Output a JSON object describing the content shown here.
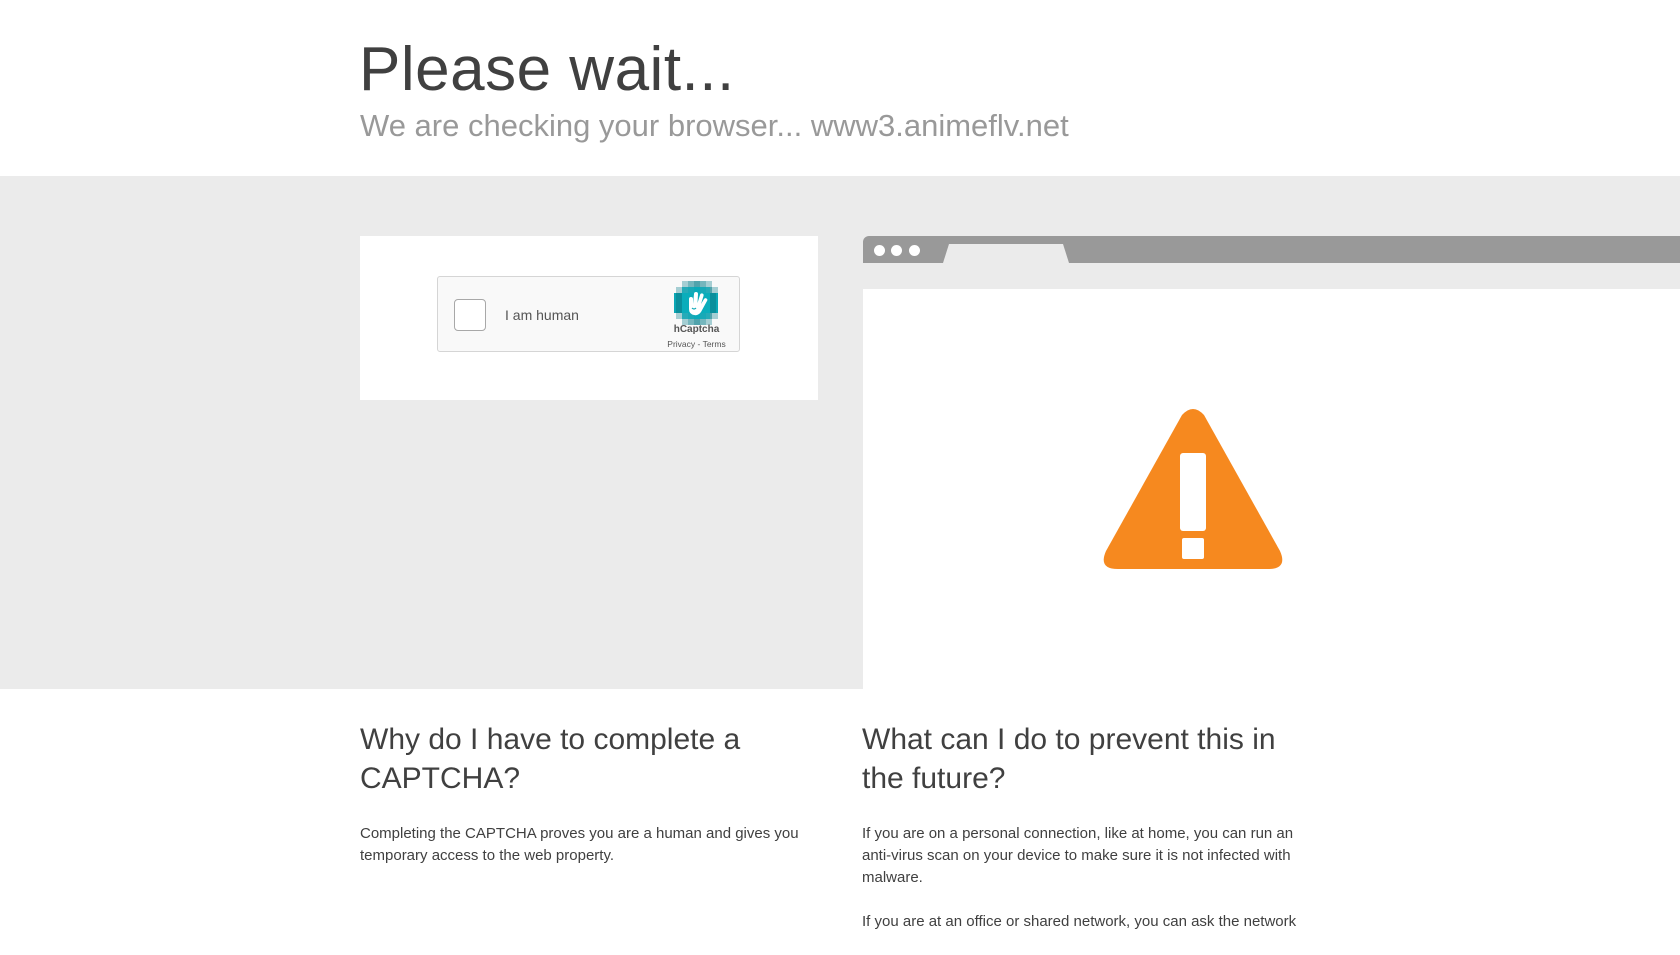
{
  "header": {
    "title": "Please wait...",
    "subtitle": "We are checking your browser... www3.animeflv.net"
  },
  "captcha": {
    "checkbox_label": "I am human",
    "brand": "hCaptcha",
    "privacy_link": "Privacy",
    "separator": " - ",
    "terms_link": "Terms",
    "logo_icon": "hcaptcha-hand-icon"
  },
  "illustration": {
    "icon": "warning-triangle-icon",
    "accent_color": "#f6891f"
  },
  "info": {
    "why": {
      "heading": "Why do I have to complete a CAPTCHA?",
      "body": "Completing the CAPTCHA proves you are a human and gives you temporary access to the web property."
    },
    "prevent": {
      "heading": "What can I do to prevent this in the future?",
      "body1": "If you are on a personal connection, like at home, you can run an anti-virus scan on your device to make sure it is not infected with malware.",
      "body2": "If you are at an office or shared network, you can ask the network"
    }
  }
}
